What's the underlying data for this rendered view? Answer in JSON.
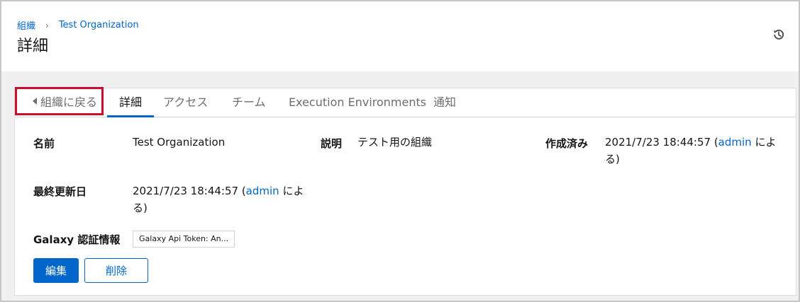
{
  "breadcrumb": {
    "parent": "組織",
    "separator": "›",
    "current": "Test Organization"
  },
  "page_title": "詳細",
  "header_icons": {
    "history": "history-icon"
  },
  "tabs": {
    "back": "組織に戻る",
    "items": [
      {
        "label": "詳細",
        "active": true
      },
      {
        "label": "アクセス",
        "active": false
      },
      {
        "label": "チーム",
        "active": false
      },
      {
        "label": "Execution Environments",
        "active": false
      },
      {
        "label": "通知",
        "active": false
      }
    ]
  },
  "details": {
    "name_label": "名前",
    "name_value": "Test Organization",
    "description_label": "説明",
    "description_value": "テスト用の組織",
    "created_label": "作成済み",
    "created_date": "2021/7/23 18:44:57 (",
    "created_user": "admin",
    "created_suffix_line1": " によ",
    "created_suffix_line2": "る)",
    "modified_label": "最終更新日",
    "modified_date": "2021/7/23 18:44:57 (",
    "modified_user": "admin",
    "modified_suffix_line1": " によ",
    "modified_suffix_line2": "る)",
    "galaxy_label": "Galaxy 認証情報",
    "galaxy_chip": "Galaxy Api Token: An..."
  },
  "actions": {
    "edit": "編集",
    "delete": "削除"
  },
  "colors": {
    "accent": "#0066cc",
    "highlight_border": "#c8102e",
    "background_band": "#f0f0f0"
  }
}
